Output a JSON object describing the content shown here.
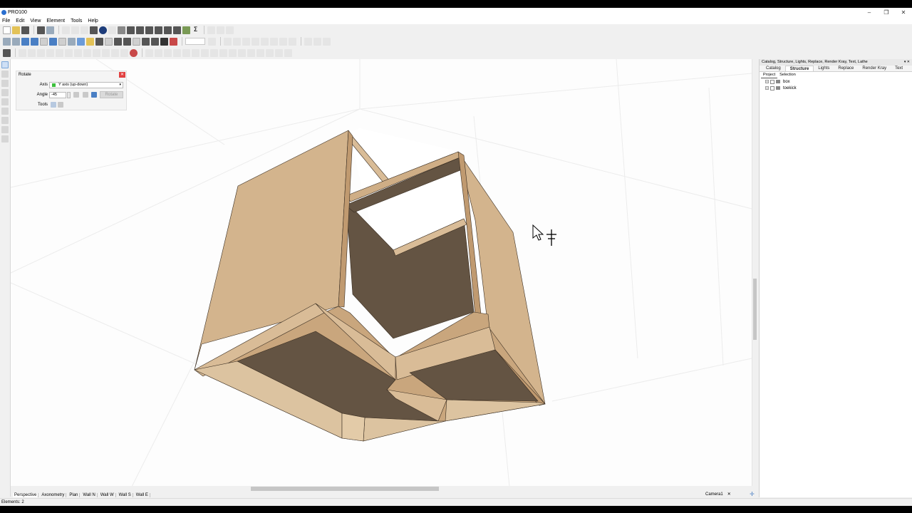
{
  "window": {
    "title": "PRO100",
    "controls": {
      "minimize": "–",
      "maximize": "❐",
      "close": "✕"
    }
  },
  "menu": [
    "File",
    "Edit",
    "View",
    "Element",
    "Tools",
    "Help"
  ],
  "toolbar": {
    "sigma_label": "Σ"
  },
  "rotate_panel": {
    "title": "Rotate",
    "close_glyph": "✕",
    "axis_label": "Axis",
    "axis_value": "Y axis (up-down)",
    "axis_color": "#3cbf3c",
    "angle_label": "Angle",
    "angle_value": "-45",
    "tools_label": "Tools",
    "rotate_button": "Rotate"
  },
  "right_panel": {
    "header": "Catalog, Structure, Lights, Replace, Render Kray, Text, Lathe",
    "tabs": [
      "Catalog",
      "Structure",
      "Lights",
      "Replace",
      "Render Kray",
      "Text"
    ],
    "active_tab": "Structure",
    "subtabs": [
      "Project",
      "Selection"
    ],
    "tree": [
      {
        "expander": "+",
        "label": "box"
      },
      {
        "expander": "+",
        "label": "toekick"
      }
    ]
  },
  "view_tabs": [
    "Perspective",
    "Axonometry",
    "Plan",
    "Wall N",
    "Wall W",
    "Wall S",
    "Wall E"
  ],
  "camera": {
    "label": "Camera1",
    "close_glyph": "✕",
    "add_glyph": "✛"
  },
  "status": {
    "text": "Elements: 2"
  },
  "colors": {
    "wood_light": "#d9bc97",
    "wood_mid": "#c9a67d",
    "wood_dark": "#645443",
    "accent": "#4a7fc4"
  }
}
